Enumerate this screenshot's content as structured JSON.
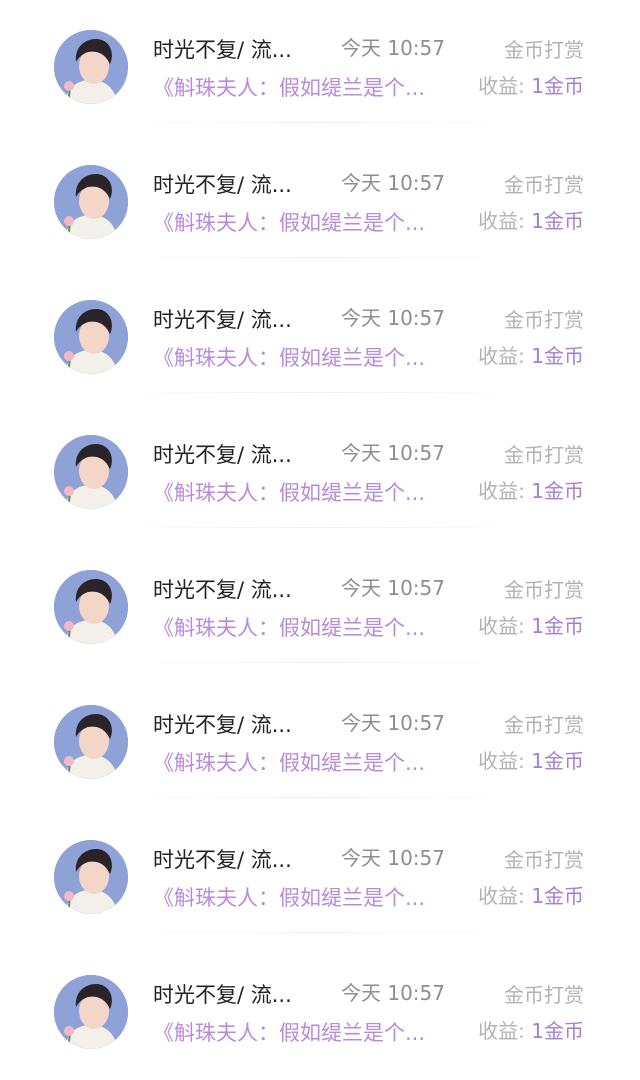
{
  "colors": {
    "title_accent": "#b98ad9",
    "earning_accent": "#a57ed4",
    "muted_text": "#b2b2b2",
    "time_text": "#8e8e8e"
  },
  "items": [
    {
      "avatar_icon": "user-avatar-icon",
      "name": "时光不复/ 流...",
      "time": "今天 10:57",
      "type": "金币打赏",
      "title": "《斛珠夫人：假如缇兰是个...",
      "earning_label": "收益:",
      "earning_value": "1金币"
    },
    {
      "avatar_icon": "user-avatar-icon",
      "name": "时光不复/ 流...",
      "time": "今天 10:57",
      "type": "金币打赏",
      "title": "《斛珠夫人：假如缇兰是个...",
      "earning_label": "收益:",
      "earning_value": "1金币"
    },
    {
      "avatar_icon": "user-avatar-icon",
      "name": "时光不复/ 流...",
      "time": "今天 10:57",
      "type": "金币打赏",
      "title": "《斛珠夫人：假如缇兰是个...",
      "earning_label": "收益:",
      "earning_value": "1金币"
    },
    {
      "avatar_icon": "user-avatar-icon",
      "name": "时光不复/ 流...",
      "time": "今天 10:57",
      "type": "金币打赏",
      "title": "《斛珠夫人：假如缇兰是个...",
      "earning_label": "收益:",
      "earning_value": "1金币"
    },
    {
      "avatar_icon": "user-avatar-icon",
      "name": "时光不复/ 流...",
      "time": "今天 10:57",
      "type": "金币打赏",
      "title": "《斛珠夫人：假如缇兰是个...",
      "earning_label": "收益:",
      "earning_value": "1金币"
    },
    {
      "avatar_icon": "user-avatar-icon",
      "name": "时光不复/ 流...",
      "time": "今天 10:57",
      "type": "金币打赏",
      "title": "《斛珠夫人：假如缇兰是个...",
      "earning_label": "收益:",
      "earning_value": "1金币"
    },
    {
      "avatar_icon": "user-avatar-icon",
      "name": "时光不复/ 流...",
      "time": "今天 10:57",
      "type": "金币打赏",
      "title": "《斛珠夫人：假如缇兰是个...",
      "earning_label": "收益:",
      "earning_value": "1金币"
    },
    {
      "avatar_icon": "user-avatar-icon",
      "name": "时光不复/ 流...",
      "time": "今天 10:57",
      "type": "金币打赏",
      "title": "《斛珠夫人：假如缇兰是个...",
      "earning_label": "收益:",
      "earning_value": "1金币"
    }
  ]
}
